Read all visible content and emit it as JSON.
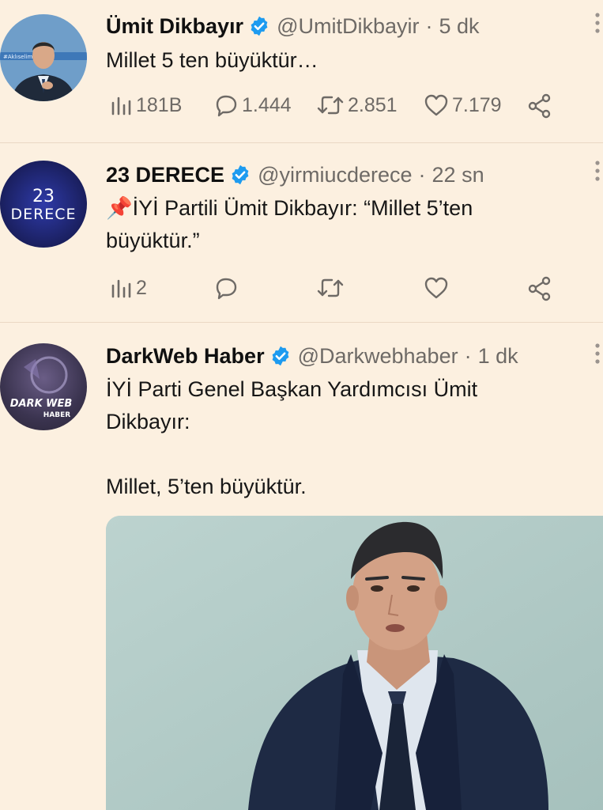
{
  "tweets": [
    {
      "name": "Ümit Dikbayır",
      "handle": "@UmitDikbayir",
      "separator": "·",
      "time": "5 dk",
      "text": "Millet 5 ten büyüktür…",
      "stats": {
        "views": "181B",
        "replies": "1.444",
        "retweets": "2.851",
        "likes": "7.179"
      }
    },
    {
      "name": "23 DERECE",
      "handle": "@yirmiucderece",
      "separator": "·",
      "time": "22 sn",
      "text_line1": "📌İYİ Partili Ümit Dikbayır: “Millet 5’ten",
      "text_line2": "büyüktür.”",
      "avatar_text_top": "23",
      "avatar_text_bottom": "DERECE",
      "stats": {
        "views": "2"
      }
    },
    {
      "name": "DarkWeb Haber",
      "handle": "@Darkwebhaber",
      "separator": "·",
      "time": "1 dk",
      "text_line1": "İYİ Parti Genel Başkan Yardımcısı Ümit",
      "text_line2": "Dikbayır:",
      "text_line3": "Millet, 5’ten büyüktür.",
      "avatar_text_top": "DARK WEB",
      "avatar_text_bottom": "HABER"
    }
  ],
  "colors": {
    "background": "#fcf0e0",
    "verified": "#1d9bf0",
    "muted": "#6e6a66"
  },
  "icons": [
    "verified-badge-icon",
    "views-icon",
    "reply-icon",
    "retweet-icon",
    "like-icon",
    "share-icon",
    "more-icon"
  ]
}
